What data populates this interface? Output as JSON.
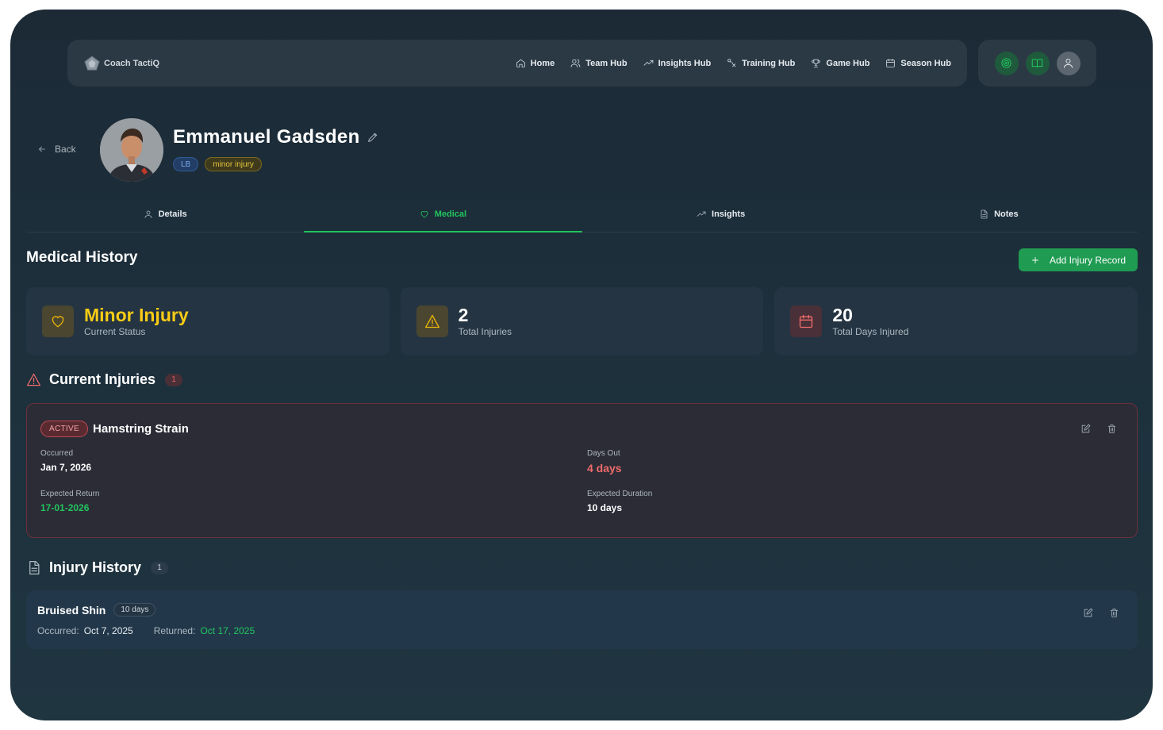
{
  "brand": {
    "name": "Coach TactiQ"
  },
  "nav": {
    "links": [
      {
        "label": "Home",
        "icon": "home-icon"
      },
      {
        "label": "Team Hub",
        "icon": "users-icon"
      },
      {
        "label": "Insights Hub",
        "icon": "trend-icon"
      },
      {
        "label": "Training Hub",
        "icon": "tactics-icon"
      },
      {
        "label": "Game Hub",
        "icon": "trophy-icon"
      },
      {
        "label": "Season Hub",
        "icon": "calendar-icon"
      }
    ],
    "right_icons": [
      "target-icon",
      "book-icon",
      "user-icon"
    ]
  },
  "header": {
    "back_label": "Back",
    "player_name": "Emmanuel Gadsden",
    "position_badge": "LB",
    "status_badge": "minor injury"
  },
  "tabs": [
    {
      "label": "Details",
      "icon": "user-icon",
      "active": false
    },
    {
      "label": "Medical",
      "icon": "heart-icon",
      "active": true
    },
    {
      "label": "Insights",
      "icon": "trend-icon",
      "active": false
    },
    {
      "label": "Notes",
      "icon": "file-icon",
      "active": false
    }
  ],
  "medical": {
    "title": "Medical History",
    "add_button": "Add Injury Record",
    "stats": [
      {
        "value": "Minor Injury",
        "label": "Current Status",
        "icon": "heart-icon",
        "color": "#facc15"
      },
      {
        "value": "2",
        "label": "Total Injuries",
        "icon": "warning-icon",
        "color": "#eab308"
      },
      {
        "value": "20",
        "label": "Total Days Injured",
        "icon": "calendar-icon",
        "color": "#ef6b6b"
      }
    ]
  },
  "current_injuries": {
    "title": "Current Injuries",
    "count": "1",
    "items": [
      {
        "status": "ACTIVE",
        "name": "Hamstring Strain",
        "occurred_label": "Occurred",
        "occurred": "Jan 7, 2026",
        "days_out_label": "Days Out",
        "days_out": "4 days",
        "expected_return_label": "Expected Return",
        "expected_return": "17-01-2026",
        "expected_duration_label": "Expected Duration",
        "expected_duration": "10 days"
      }
    ]
  },
  "injury_history": {
    "title": "Injury History",
    "count": "1",
    "items": [
      {
        "name": "Bruised Shin",
        "duration": "10 days",
        "occurred_label": "Occurred:",
        "occurred": "Oct 7, 2025",
        "returned_label": "Returned:",
        "returned": "Oct 17, 2025"
      }
    ]
  },
  "colors": {
    "accent_green": "#22c55e",
    "warning_yellow": "#facc15",
    "danger_red": "#ef6b6b"
  }
}
